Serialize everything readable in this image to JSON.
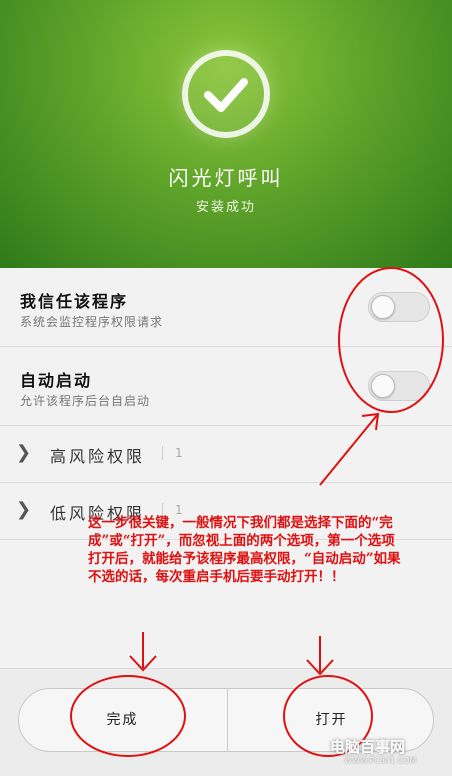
{
  "header": {
    "app_name": "闪光灯呼叫",
    "status": "安装成功",
    "icon": "checkmark-icon"
  },
  "settings": [
    {
      "title": "我信任该程序",
      "subtitle": "系统会监控程序权限请求",
      "toggle_on": false
    },
    {
      "title": "自动启动",
      "subtitle": "允许该程序后台自启动",
      "toggle_on": false
    }
  ],
  "permissions": [
    {
      "label": "高风险权限",
      "count": "1"
    },
    {
      "label": "低风险权限",
      "count": "1"
    }
  ],
  "annotation": {
    "text": "这一步很关键，一般情况下我们都是选择下面的“完成”或“打开”，而忽视上面的两个选项，第一个选项打开后，就能给予该程序最高权限，“自动启动”如果不选的话，每次重启手机后要手动打开！！"
  },
  "buttons": {
    "done": "完成",
    "open": "打开"
  },
  "watermark": {
    "title": "电脑百事网",
    "url": "WWW.PC841.COM"
  },
  "colors": {
    "header_green": "#5ea32a",
    "annotation_red": "#e01010"
  }
}
